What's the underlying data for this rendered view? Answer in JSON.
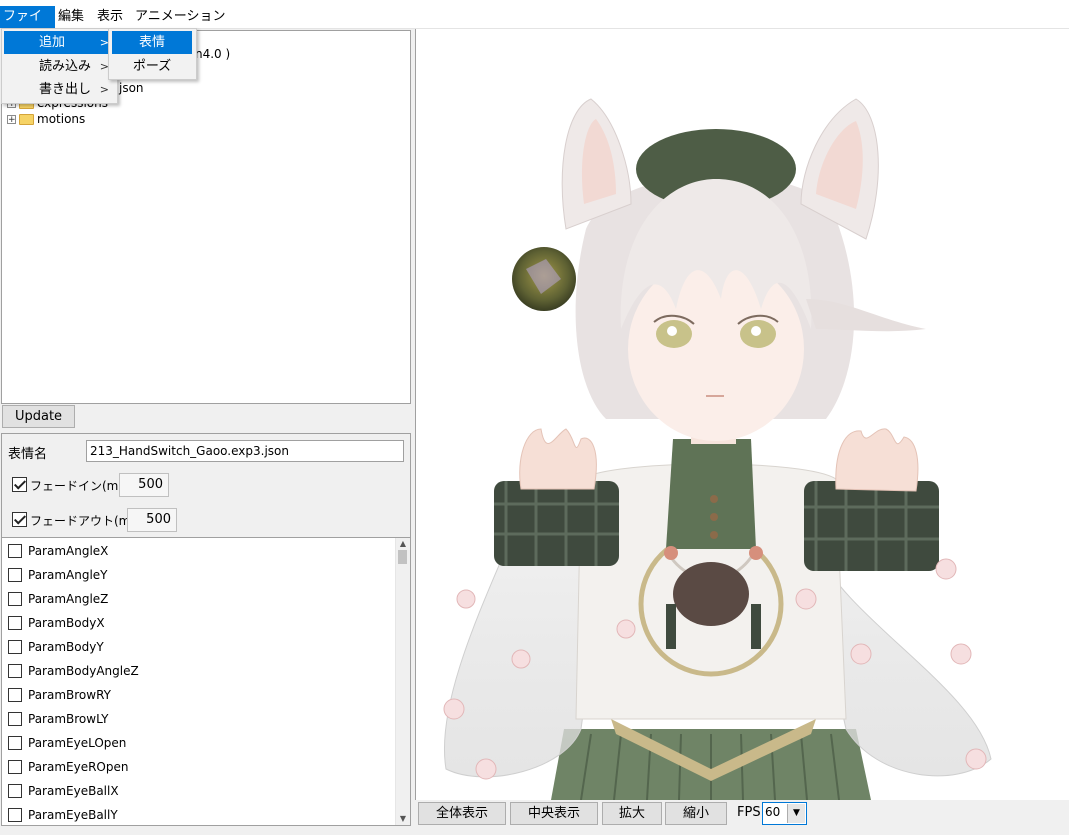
{
  "menubar": {
    "file": "ファイル",
    "edit": "編集",
    "view": "表示",
    "animation": "アニメーション"
  },
  "file_menu": {
    "items": [
      {
        "label": "追加",
        "has_submenu": true,
        "highlighted": true
      },
      {
        "label": "読み込み",
        "has_submenu": true
      },
      {
        "label": "書き出し",
        "has_submenu": true
      }
    ],
    "submenu_arrow": ">"
  },
  "add_submenu": {
    "items": [
      {
        "label": "表情",
        "highlighted": true
      },
      {
        "label": "ポーズ"
      }
    ]
  },
  "tree": {
    "fragment_version": "n4.0 )",
    "fragment_json": "json",
    "fragment_expressions": "expressions",
    "motions_label": "motions",
    "expander": "+"
  },
  "update_button": "Update",
  "expression": {
    "name_label": "表情名",
    "name_value": "213_HandSwitch_Gaoo.exp3.json",
    "fade_in_label": "フェードイン(ms)",
    "fade_in_checked": true,
    "fade_in_value": "500",
    "fade_out_label": "フェードアウト(ms)",
    "fade_out_checked": true,
    "fade_out_value": "500"
  },
  "params": [
    "ParamAngleX",
    "ParamAngleY",
    "ParamAngleZ",
    "ParamBodyX",
    "ParamBodyY",
    "ParamBodyAngleZ",
    "ParamBrowRY",
    "ParamBrowLY",
    "ParamEyeLOpen",
    "ParamEyeROpen",
    "ParamEyeBallX",
    "ParamEyeBallY"
  ],
  "viewer_buttons": {
    "show_all": "全体表示",
    "center": "中央表示",
    "zoom_in": "拡大",
    "zoom_out": "縮小"
  },
  "fps": {
    "label": "FPS",
    "value": "60"
  },
  "colors": {
    "accent": "#0078d7",
    "panel_bg": "#f0f0f0",
    "hair": "#e8e2e2",
    "jacket_green": "#5b6f52",
    "plaid": "#3f4a3e",
    "skirt": "#6f8466"
  },
  "icons": {
    "folder": "folder-icon",
    "expander": "expand-plus-icon",
    "dropdown": "chevron-down-icon",
    "scroll_up": "scroll-up-arrow-icon"
  }
}
